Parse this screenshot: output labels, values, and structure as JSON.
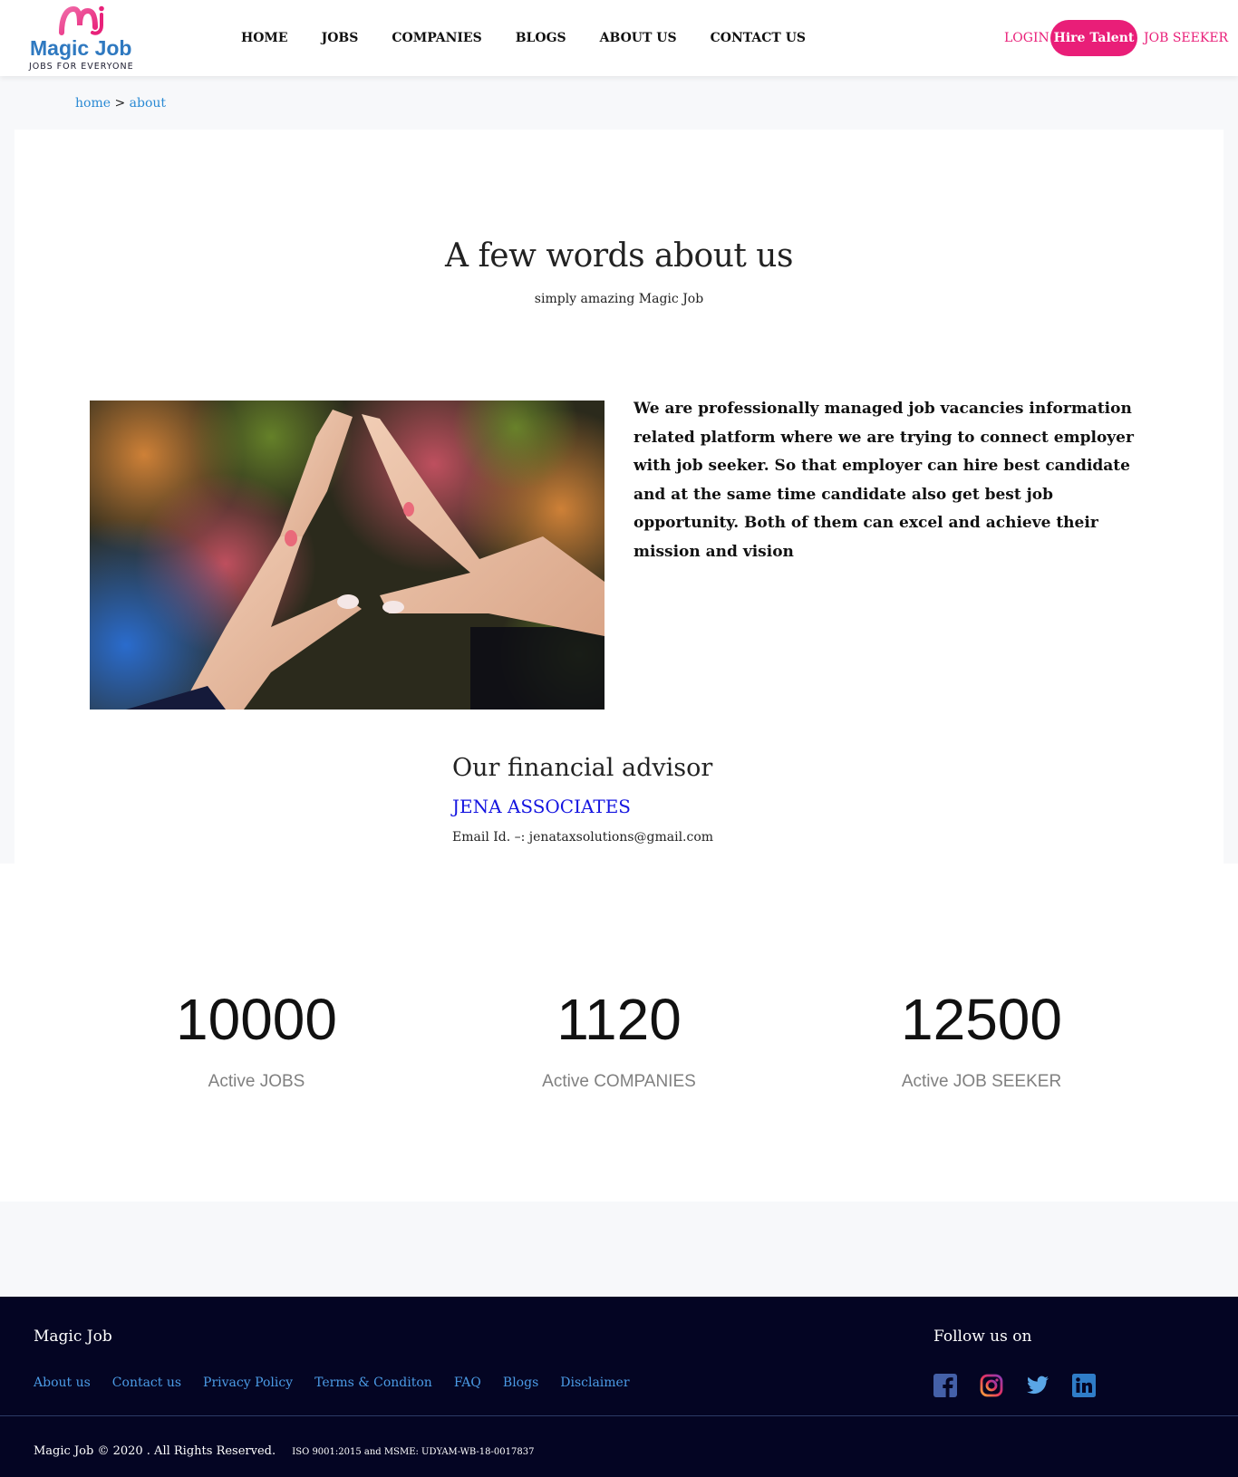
{
  "brand": {
    "name": "Magic Job",
    "tagline": "JOBS FOR EVERYONE",
    "accent": "#e91e78",
    "blue": "#2f79c0"
  },
  "nav": {
    "items": [
      "HOME",
      "JOBS",
      "COMPANIES",
      "BLOGS",
      "ABOUT US",
      "CONTACT US"
    ],
    "login": "LOGIN",
    "hire_talent": "Hire Talent",
    "job_seeker": "JOB SEEKER"
  },
  "breadcrumb": {
    "home": "home",
    "separator": ">",
    "current": "about"
  },
  "about": {
    "title": "A few words about us",
    "subtitle": "simply amazing Magic Job",
    "body": "We are professionally managed job vacancies information related platform where we are trying to connect employer with job seeker. So that employer can hire best candidate and at the same time candidate also get best job opportunity. Both of them can excel and achieve their mission and vision"
  },
  "advisor": {
    "title": "Our financial advisor",
    "name": "JENA ASSOCIATES",
    "email": "Email Id. –: jenataxsolutions@gmail.com"
  },
  "stats": [
    {
      "value": "10000",
      "label": "Active JOBS"
    },
    {
      "value": "1120",
      "label": "Active COMPANIES"
    },
    {
      "value": "12500",
      "label": "Active JOB SEEKER"
    }
  ],
  "footer": {
    "brand": "Magic Job",
    "links": [
      "About us",
      "Contact us",
      "Privacy Policy",
      "Terms & Conditon",
      "FAQ",
      "Blogs",
      "Disclaimer"
    ],
    "follow": "Follow us on",
    "socials": [
      "facebook-icon",
      "instagram-icon",
      "twitter-icon",
      "linkedin-icon"
    ],
    "copyright": "Magic Job © 2020 . All Rights Reserved.",
    "iso": "ISO 9001:2015 and MSME: UDYAM-WB-18-0017837"
  }
}
